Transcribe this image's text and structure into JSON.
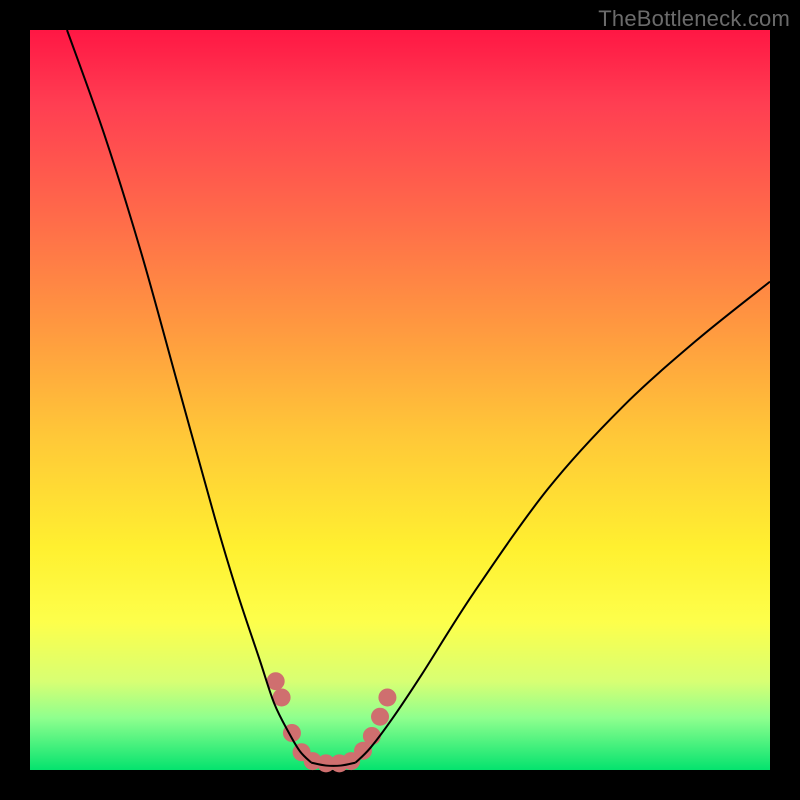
{
  "watermark": "TheBottleneck.com",
  "chart_data": {
    "type": "line",
    "title": "",
    "xlabel": "",
    "ylabel": "",
    "xlim": [
      0,
      100
    ],
    "ylim": [
      0,
      100
    ],
    "series": [
      {
        "name": "left-curve",
        "x": [
          5,
          10,
          15,
          20,
          25,
          28,
          31,
          33,
          35,
          36.5,
          38
        ],
        "y": [
          100,
          86,
          70,
          52,
          34,
          24,
          15,
          9,
          5,
          2.5,
          1
        ]
      },
      {
        "name": "right-curve",
        "x": [
          44,
          46,
          49,
          53,
          60,
          70,
          80,
          90,
          100
        ],
        "y": [
          1,
          3,
          7,
          13,
          24,
          38,
          49,
          58,
          66
        ]
      },
      {
        "name": "valley-floor",
        "x": [
          38,
          40,
          42,
          44
        ],
        "y": [
          1,
          0.6,
          0.6,
          1
        ]
      }
    ],
    "markers": {
      "name": "valley-dots",
      "color": "#cf6f6f",
      "points": [
        {
          "x": 33.2,
          "y": 12.0
        },
        {
          "x": 34.0,
          "y": 9.8
        },
        {
          "x": 35.4,
          "y": 5.0
        },
        {
          "x": 36.7,
          "y": 2.4
        },
        {
          "x": 38.2,
          "y": 1.2
        },
        {
          "x": 40.0,
          "y": 0.9
        },
        {
          "x": 41.8,
          "y": 0.9
        },
        {
          "x": 43.4,
          "y": 1.2
        },
        {
          "x": 45.0,
          "y": 2.6
        },
        {
          "x": 46.2,
          "y": 4.6
        },
        {
          "x": 47.3,
          "y": 7.2
        },
        {
          "x": 48.3,
          "y": 9.8
        }
      ]
    },
    "colors": {
      "curve_stroke": "#000000",
      "marker_fill": "#cf6f6f",
      "gradient_top": "#ff1744",
      "gradient_bottom": "#04e36e"
    }
  }
}
